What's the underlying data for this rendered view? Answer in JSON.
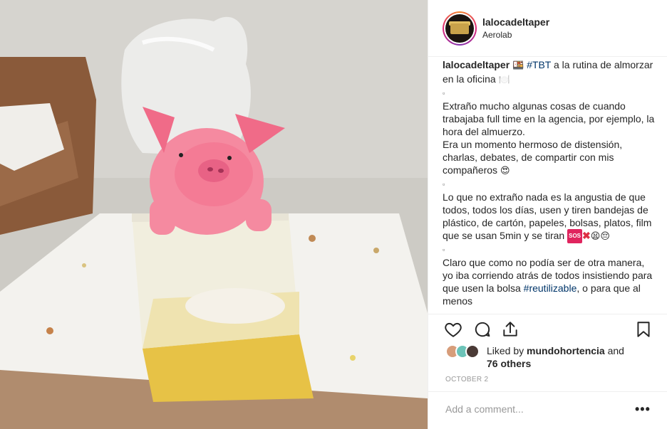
{
  "post": {
    "username": "lalocadeltaper",
    "location": "Aerolab",
    "caption": {
      "line1_after_user_emoji": "🍱",
      "hashtag_tbt": "#TBT",
      "line1_rest": " a la rutina de almorzar en la oficina",
      "plate_emoji": "🍽️",
      "dot": "▫",
      "para2": "Extraño mucho algunas cosas de cuando trabajaba full time en la agencia, por ejemplo, la hora del almuerzo.",
      "para3": "Era un momento hermoso de distensión, charlas, debates, de compartir con mis compañeros",
      "heart_eyes": "😍",
      "para4": "Lo que no extraño nada es la angustia de que todos, todos los días, usen y tiren bandejas de plástico, de cartón, papeles, bolsas, platos, film que se usan 5min y se tiran",
      "sos": "SOS",
      "cross": "✖",
      "tired": "😫",
      "sad": "😔",
      "para5": "Claro que como no podía ser de otra manera, yo iba corriendo atrás de todos insistiendo para que usen la bolsa",
      "hashtag_reutilizable": "#reutilizable",
      "para5_tail": ", o para que al menos"
    },
    "likes": {
      "prefix": "Liked by ",
      "user": "mundohortencia",
      "and": " and",
      "others": "76 others"
    },
    "date": "OCTOBER 2",
    "comment_placeholder": "Add a comment...",
    "more_label": "•••"
  },
  "icons": {
    "like": "heart-icon",
    "comment": "comment-icon",
    "share": "share-icon",
    "save": "bookmark-icon"
  },
  "colors": {
    "hashtag": "#003569",
    "muted": "#999999",
    "border": "#efefef",
    "text": "#262626"
  }
}
